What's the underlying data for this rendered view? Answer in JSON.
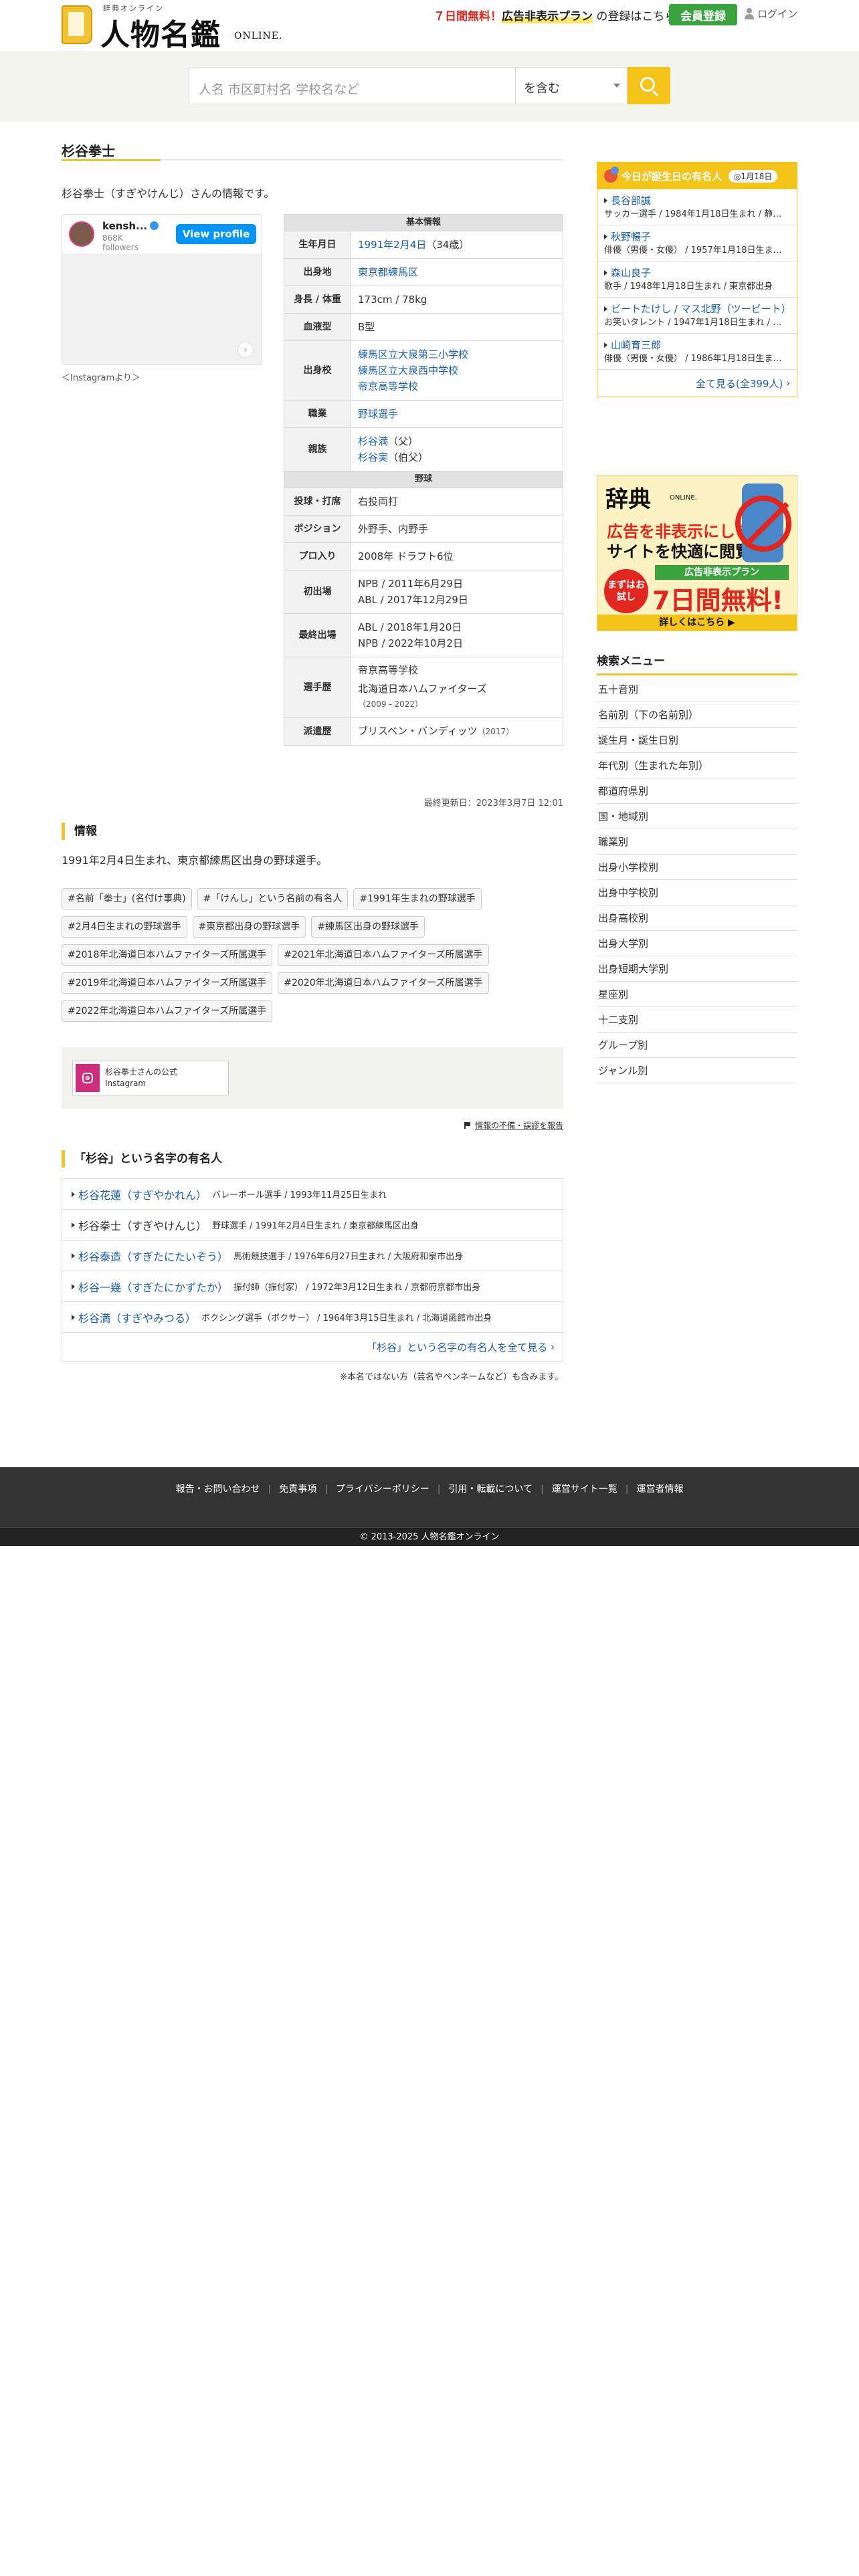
{
  "header": {
    "logo_small": "辞典オンライン",
    "logo_main": "人物名鑑",
    "logo_online": "ONLINE.",
    "promo_red": "７日間無料！",
    "promo_hl": "広告非表示プラン",
    "promo_rest": "の登録はこちら",
    "register": "会員登録",
    "login": "ログイン"
  },
  "search": {
    "placeholder": "人名 市区町村名 学校名など",
    "mode": "を含む"
  },
  "page": {
    "title": "杉谷拳士",
    "lead": "杉谷拳士（すぎやけんじ）さんの情報です。"
  },
  "instagram": {
    "username": "kensh...",
    "count": "868K",
    "followers": "followers",
    "view_profile": "View profile",
    "caption": "＜Instagramより＞"
  },
  "basic": {
    "section": "基本情報",
    "rows": [
      {
        "label": "生年月日",
        "link": "1991年2月4日",
        "text": "（34歳）"
      },
      {
        "label": "出身地",
        "link": "東京都練馬区"
      },
      {
        "label": "身長 / 体重",
        "text": "173cm / 78kg"
      },
      {
        "label": "血液型",
        "text": "B型"
      },
      {
        "label": "出身校",
        "links": [
          "練馬区立大泉第三小学校",
          "練馬区立大泉西中学校",
          "帝京高等学校"
        ]
      },
      {
        "label": "職業",
        "link": "野球選手"
      },
      {
        "label": "親族",
        "rel": [
          {
            "name": "杉谷満",
            "role": "（父）"
          },
          {
            "name": "杉谷実",
            "role": "（伯父）"
          }
        ]
      }
    ]
  },
  "baseball": {
    "section": "野球",
    "rows": [
      {
        "label": "投球・打席",
        "text": "右投両打"
      },
      {
        "label": "ポジション",
        "text": "外野手、内野手"
      },
      {
        "label": "プロ入り",
        "text": "2008年 ドラフト6位"
      },
      {
        "label": "初出場",
        "lines": [
          "NPB / 2011年6月29日",
          "ABL / 2017年12月29日"
        ]
      },
      {
        "label": "最終出場",
        "lines": [
          "ABL / 2018年1月20日",
          "NPB / 2022年10月2日"
        ]
      },
      {
        "label": "選手歴",
        "lines": [
          "帝京高等学校",
          "北海道日本ハムファイターズ"
        ],
        "sub": "（2009 - 2022）"
      },
      {
        "label": "派遣歴",
        "text": "ブリスベン・バンディッツ",
        "sub": "（2017）"
      }
    ]
  },
  "updated": "最終更新日：2023年3月7日 12:01",
  "joho": {
    "heading": "情報",
    "text": "1991年2月4日生まれ、東京都練馬区出身の野球選手。",
    "tags": [
      "#名前「拳士」(名付け事典)",
      "#「けんし」という名前の有名人",
      "#1991年生まれの野球選手",
      "#2月4日生まれの野球選手",
      "#東京都出身の野球選手",
      "#練馬区出身の野球選手",
      "#2018年北海道日本ハムファイターズ所属選手",
      "#2021年北海道日本ハムファイターズ所属選手",
      "#2019年北海道日本ハムファイターズ所属選手",
      "#2020年北海道日本ハムファイターズ所属選手",
      "#2022年北海道日本ハムファイターズ所属選手"
    ]
  },
  "official": {
    "line1": "杉谷拳士さんの公式",
    "line2": "Instagram"
  },
  "report": "情報の不備・誤謬を報告",
  "surname": {
    "heading": "「杉谷」という名字の有名人",
    "items": [
      {
        "name": "杉谷花蓮（すぎやかれん）",
        "desc": "バレーボール選手 / 1993年11月25日生まれ",
        "link": true
      },
      {
        "name": "杉谷拳士（すぎやけんじ）",
        "desc": "野球選手 / 1991年2月4日生まれ / 東京都練馬区出身",
        "link": false
      },
      {
        "name": "杉谷泰造（すぎたにたいぞう）",
        "desc": "馬術競技選手 / 1976年6月27日生まれ / 大阪府和泉市出身",
        "link": true
      },
      {
        "name": "杉谷一幾（すぎたにかずたか）",
        "desc": "振付師（振付家） / 1972年3月12日生まれ / 京都府京都市出身",
        "link": true
      },
      {
        "name": "杉谷満（すぎやみつる）",
        "desc": "ボクシング選手（ボクサー） / 1964年3月15日生まれ / 北海道函館市出身",
        "link": true
      }
    ],
    "more": "「杉谷」という名字の有名人を全て見る",
    "note": "※本名ではない方（芸名やペンネームなど）も含みます。"
  },
  "bday": {
    "title": "今日が誕生日の有名人",
    "date": "1月18日",
    "items": [
      {
        "name": "長谷部誠",
        "desc": "サッカー選手 / 1984年1月18日生まれ / 静岡県出身"
      },
      {
        "name": "秋野暢子",
        "desc": "俳優（男優・女優） / 1957年1月18日生まれ / 大阪府出身"
      },
      {
        "name": "森山良子",
        "desc": "歌手 / 1948年1月18日生まれ / 東京都出身"
      },
      {
        "name": "ビートたけし / マス北野（ツービート）",
        "desc": "お笑いタレント / 1947年1月18日生まれ / 東京都出身"
      },
      {
        "name": "山崎育三郎",
        "desc": "俳優（男優・女優） / 1986年1月18日生まれ / 東京都出身"
      }
    ],
    "more": "全て見る(全399人)"
  },
  "ad": {
    "jiten": "辞典",
    "online": "ONLINE.",
    "line1": "広告を非表示にして",
    "line2": "サイトを快適に閲覧",
    "badge": "まずはお試し",
    "green": "広告非表示プラン",
    "big": "7日間無料!",
    "cta": "詳しくはこちら ▶"
  },
  "menu": {
    "heading": "検索メニュー",
    "items": [
      "五十音別",
      "名前別（下の名前別）",
      "誕生月・誕生日別",
      "年代別（生まれた年別）",
      "都道府県別",
      "国・地域別",
      "職業別",
      "出身小学校別",
      "出身中学校別",
      "出身高校別",
      "出身大学別",
      "出身短期大学別",
      "星座別",
      "十二支別",
      "グループ別",
      "ジャンル別"
    ]
  },
  "footer": {
    "links": [
      "報告・お問い合わせ",
      "免責事項",
      "プライバシーポリシー",
      "引用・転載について",
      "運営サイト一覧",
      "運営者情報"
    ],
    "copy": "© 2013-2025 人物名鑑オンライン"
  }
}
